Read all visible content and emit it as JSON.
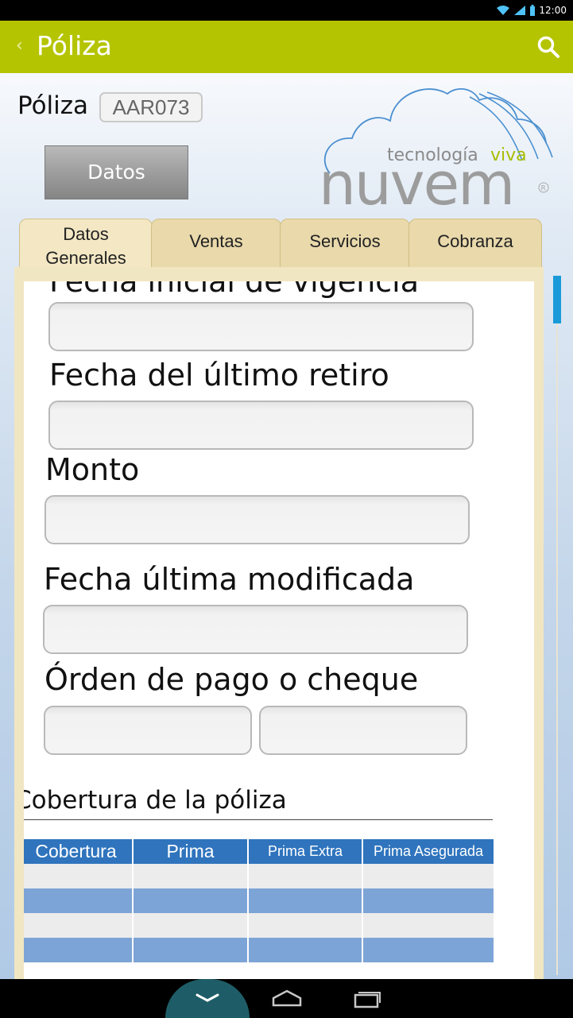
{
  "status_bar": {
    "time": "12:00",
    "icons": [
      "wifi-icon",
      "signal-icon",
      "battery-icon"
    ]
  },
  "app_bar": {
    "title": "Póliza",
    "back_icon": "chevron-left-icon",
    "search_icon": "search-icon",
    "color": "#b5c400"
  },
  "header": {
    "poliza_label": "Póliza",
    "poliza_code": "AAR073",
    "datos_button": "Datos"
  },
  "logo": {
    "tagline_part1": "tecnología",
    "tagline_part2": "viva",
    "brand": "nuvem",
    "registered": "R"
  },
  "tabs": [
    {
      "line1": "Datos",
      "line2": "Generales",
      "active": true
    },
    {
      "label": "Ventas",
      "active": false
    },
    {
      "label": "Servicios",
      "active": false
    },
    {
      "label": "Cobranza",
      "active": false
    }
  ],
  "form": {
    "fields": [
      {
        "label": "Fecha inicial de vigencia",
        "value": ""
      },
      {
        "label": "Fecha del último retiro",
        "value": ""
      },
      {
        "label": "Monto",
        "value": ""
      },
      {
        "label": "Fecha última modificada",
        "value": ""
      },
      {
        "label": "Órden de pago o cheque",
        "value_1": "",
        "value_2": ""
      }
    ]
  },
  "coverage": {
    "title": "Cobertura de la póliza",
    "headers": [
      "Cobertura",
      "Prima",
      "Prima Extra",
      "Prima Asegurada"
    ],
    "rows": [
      [
        "",
        "",
        "",
        ""
      ],
      [
        "",
        "",
        "",
        ""
      ],
      [
        "",
        "",
        "",
        ""
      ],
      [
        "",
        "",
        "",
        ""
      ]
    ]
  },
  "colors": {
    "accent": "#b5c400",
    "table_header": "#2f74bd",
    "table_row_alt": "#7da4d6",
    "tab_bg": "#e9d9ab"
  },
  "nav_bar": {
    "icons": [
      "chevron-down-icon",
      "home-icon",
      "recents-icon"
    ]
  }
}
